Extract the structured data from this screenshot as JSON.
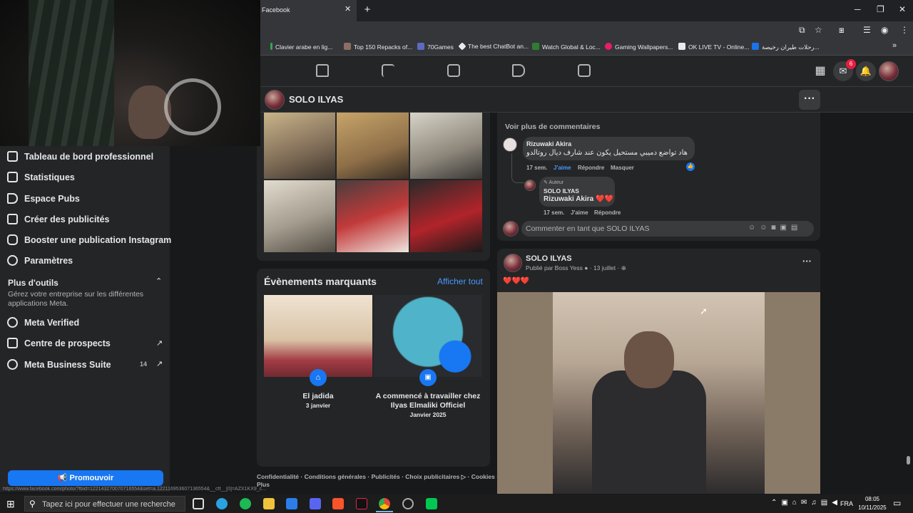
{
  "browser": {
    "tab_title": "Facebook",
    "bookmarks": [
      "Clavier arabe en lig...",
      "Top 150 Repacks of...",
      "70Games",
      "The best ChatBot an...",
      "Watch Global & Loc...",
      "Gaming Wallpapers...",
      "OK LIVE TV - Online...",
      "رحلات طيران رخيصة..."
    ],
    "status_url": "https://www.facebook.com/photo/?fbid=122143270070716554&set=a.122116953607136554&__cft__[0]=AZX1KX9_c..."
  },
  "fb_nav": {
    "messenger_badge": "6"
  },
  "page": {
    "name": "SOLO ILYAS"
  },
  "sidebar": {
    "items": [
      "Tableau de bord professionnel",
      "Statistiques",
      "Espace Pubs",
      "Créer des publicités",
      "Booster une publication Instagram",
      "Paramètres"
    ],
    "more_tools_title": "Plus d'outils",
    "more_tools_desc": "Gérez votre entreprise sur les différentes applications Meta.",
    "tools": [
      "Meta Verified",
      "Centre de prospects",
      "Meta Business Suite"
    ],
    "business_suite_count": "14",
    "promote_label": "Promouvoir"
  },
  "events": {
    "title": "Évènements marquants",
    "see_all": "Afficher tout",
    "items": [
      {
        "title": "El jadida",
        "date": "3 janvier"
      },
      {
        "title": "A commencé à travailler chez Ilyas Elmaliki Officiel",
        "date": "Janvier 2025"
      }
    ]
  },
  "footer_links": "Confidentialité · Conditions générales · Publicités · Choix publicitaires ▷ · Cookies ·",
  "footer_more": "Plus",
  "comments": {
    "see_more": "Voir plus de commentaires",
    "c1": {
      "author": "Rizuwaki Akira",
      "text": "هاد تواضع دميبي مستحيل يكون عند شارف ديال روتالدو",
      "age": "17 sem.",
      "like": "J'aime",
      "reply": "Répondre",
      "hide": "Masquer"
    },
    "c2": {
      "badge": "Auteur",
      "author": "SOLO ILYAS",
      "text": "Rizuwaki Akira ❤️❤️",
      "age": "17 sem.",
      "like": "J'aime",
      "reply": "Répondre"
    },
    "input_placeholder": "Commenter en tant que SOLO ILYAS"
  },
  "post": {
    "author": "SOLO ILYAS",
    "meta": "Publié par Boss Yess",
    "date": "13 juillet",
    "text": "❤️❤️❤️"
  },
  "taskbar": {
    "search_placeholder": "Tapez ici pour effectuer une recherche",
    "lang": "FRA",
    "time": "08:05",
    "date": "10/11/2025"
  }
}
